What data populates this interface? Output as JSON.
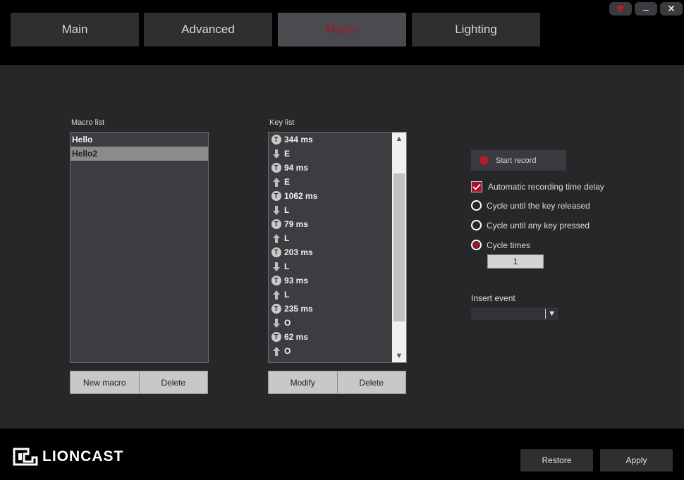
{
  "tabs": [
    "Main",
    "Advanced",
    "Macro",
    "Lighting"
  ],
  "window_controls": {
    "menu_icon": "down-triangle-icon",
    "minimize": "–",
    "close": "✕"
  },
  "macro_list": {
    "label": "Macro list",
    "items": [
      "Hello",
      "Hello2"
    ],
    "selected_index": 1,
    "buttons": {
      "new": "New macro",
      "delete": "Delete"
    }
  },
  "key_list": {
    "label": "Key list",
    "items": [
      {
        "type": "time",
        "text": "344 ms"
      },
      {
        "type": "down",
        "text": "E"
      },
      {
        "type": "time",
        "text": "94 ms"
      },
      {
        "type": "up",
        "text": "E"
      },
      {
        "type": "time",
        "text": "1062 ms"
      },
      {
        "type": "down",
        "text": "L"
      },
      {
        "type": "time",
        "text": "79 ms"
      },
      {
        "type": "up",
        "text": "L"
      },
      {
        "type": "time",
        "text": "203 ms"
      },
      {
        "type": "down",
        "text": "L"
      },
      {
        "type": "time",
        "text": "93 ms"
      },
      {
        "type": "up",
        "text": "L"
      },
      {
        "type": "time",
        "text": "235 ms"
      },
      {
        "type": "down",
        "text": "O"
      },
      {
        "type": "time",
        "text": "62 ms"
      },
      {
        "type": "up",
        "text": "O"
      }
    ],
    "time_icon_glyph": "T",
    "buttons": {
      "modify": "Modify",
      "delete": "Delete"
    }
  },
  "record": {
    "start_label": "Start record"
  },
  "options": {
    "auto_delay": {
      "label": "Automatic recording time delay",
      "checked": true
    },
    "cycle_release": {
      "label": "Cycle until the key released"
    },
    "cycle_any": {
      "label": "Cycle until any key pressed"
    },
    "cycle_times": {
      "label": "Cycle times",
      "selected": true,
      "value": "1"
    }
  },
  "insert_event": {
    "label": "Insert event",
    "value": ""
  },
  "footer": {
    "brand": "LIONCAST",
    "restore": "Restore",
    "apply": "Apply"
  },
  "colors": {
    "accent": "#a8112a",
    "bg": "#262729"
  }
}
